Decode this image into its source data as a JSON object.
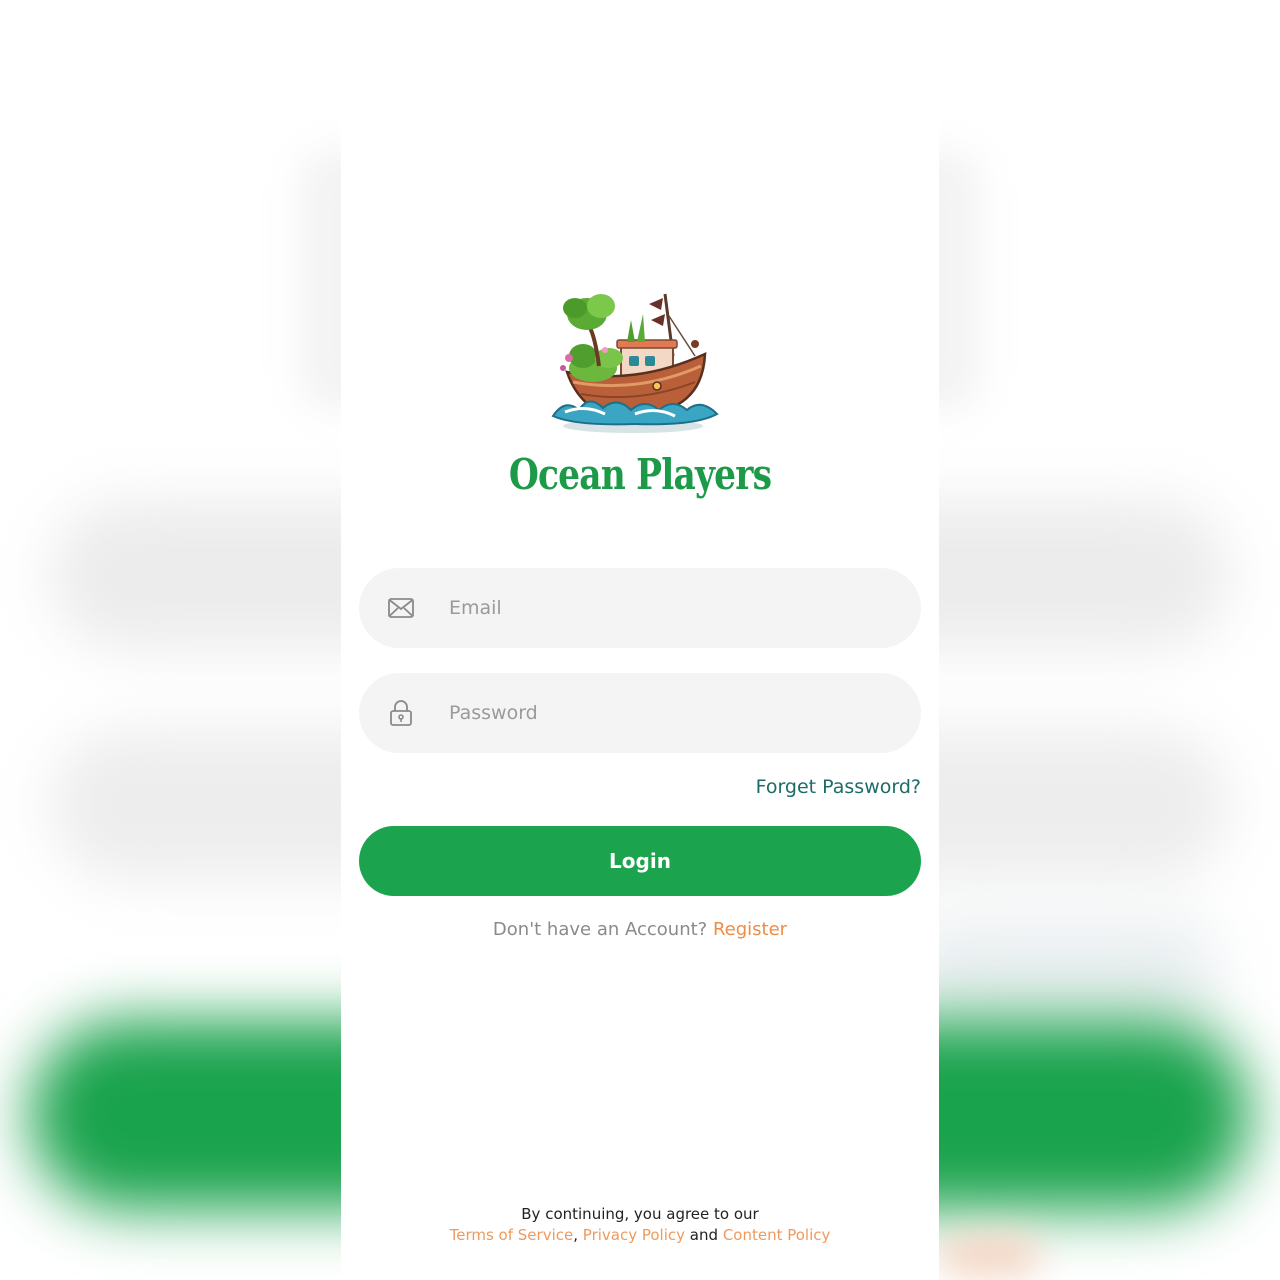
{
  "app": {
    "brand_name": "Ocean Players",
    "logo_icon": "boat-island-logo"
  },
  "form": {
    "email": {
      "placeholder": "Email",
      "value": "",
      "icon": "envelope-icon"
    },
    "password": {
      "placeholder": "Password",
      "value": "",
      "icon": "lock-icon"
    },
    "forgot_label": "Forget Password?",
    "login_label": "Login"
  },
  "register": {
    "prompt": "Don't have an Account?",
    "link_label": "Register"
  },
  "footer": {
    "intro": "By continuing, you agree to our",
    "terms_label": "Terms of Service",
    "comma": ",",
    "privacy_label": "Privacy Policy",
    "and": "and",
    "content_label": "Content Policy"
  },
  "colors": {
    "brand_green": "#1ba34e",
    "link_orange": "#ef8b45",
    "forgot_teal": "#1d6b67",
    "field_bg": "#f4f4f4"
  }
}
